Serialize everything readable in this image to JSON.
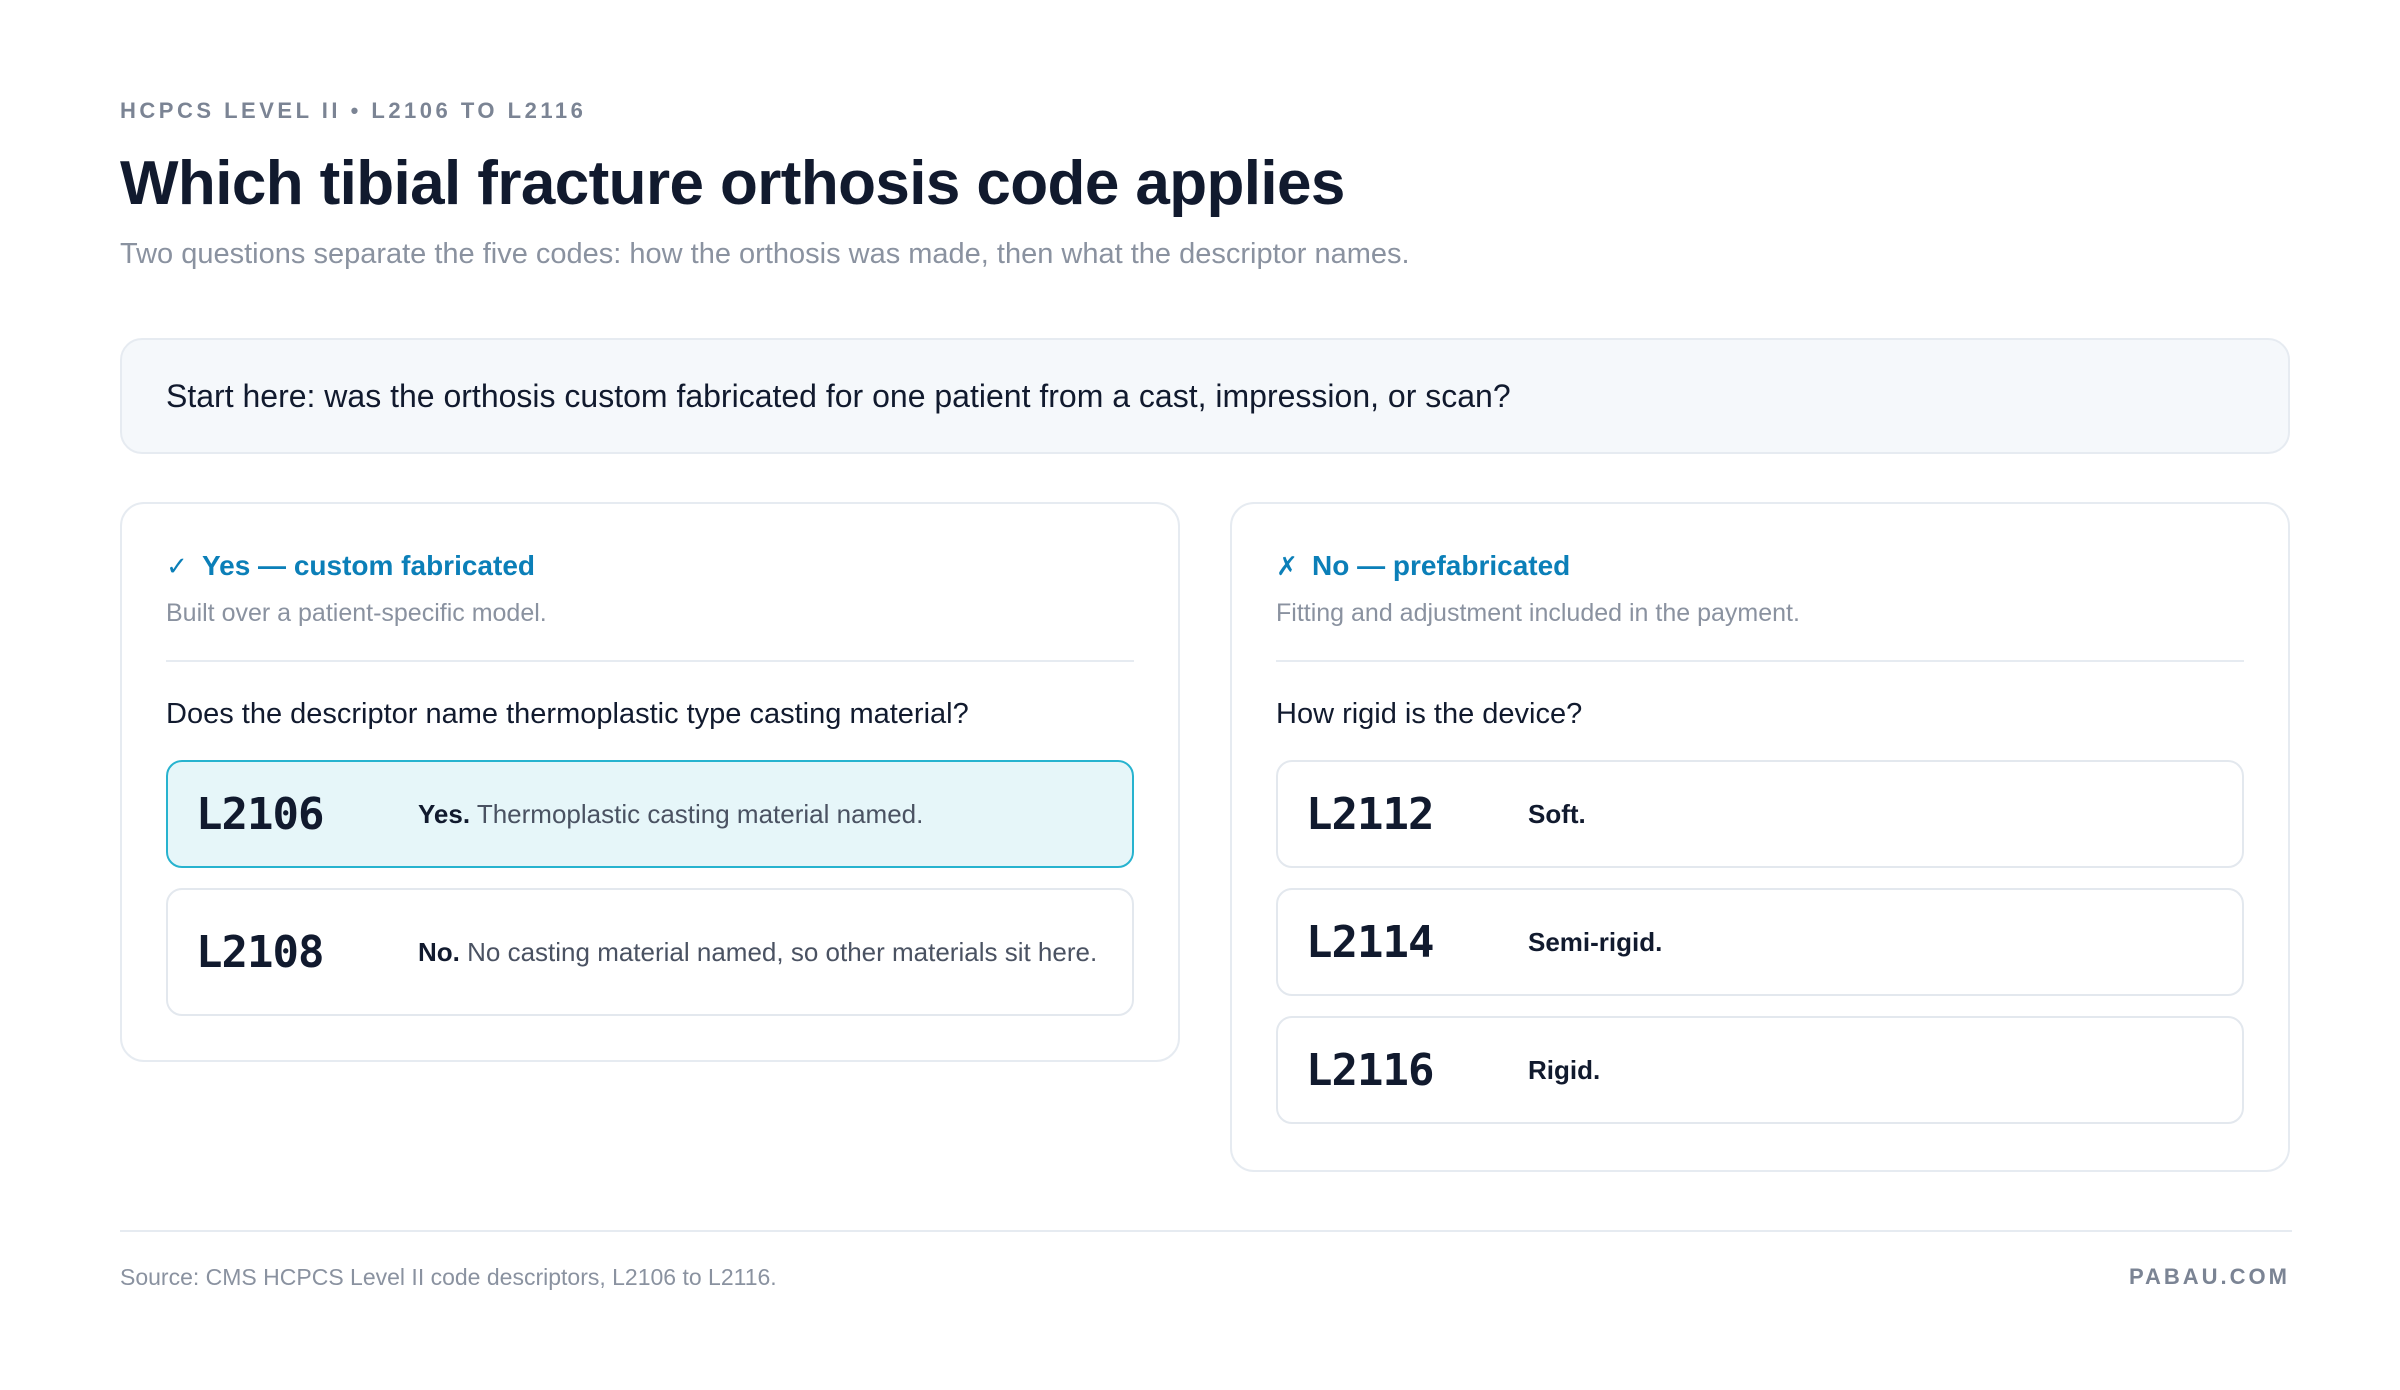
{
  "header": {
    "eyebrow": "HCPCS LEVEL II • L2106 TO L2116",
    "title": "Which tibial fracture orthosis code applies",
    "subtitle": "Two questions separate the five codes: how the orthosis was made, then what the descriptor names."
  },
  "start": {
    "text": "Start here: was the orthosis custom fabricated for one patient from a cast, impression, or scan?"
  },
  "left": {
    "icon": "check-icon",
    "icon_glyph": "✓",
    "heading": "Yes — custom fabricated",
    "note": "Built over a patient-specific model.",
    "question": "Does the descriptor name thermoplastic type casting material?",
    "options": [
      {
        "code": "L2106",
        "lead": "Yes.",
        "text": "Thermoplastic casting material named.",
        "highlighted": true
      },
      {
        "code": "L2108",
        "lead": "No.",
        "text": "No casting material named, so other materials sit here.",
        "highlighted": false
      }
    ]
  },
  "right": {
    "icon": "cross-icon",
    "icon_glyph": "✗",
    "heading": "No — prefabricated",
    "note": "Fitting and adjustment included in the payment.",
    "question": "How rigid is the device?",
    "options": [
      {
        "code": "L2112",
        "lead": "Soft.",
        "text": ""
      },
      {
        "code": "L2114",
        "lead": "Semi-rigid.",
        "text": ""
      },
      {
        "code": "L2116",
        "lead": "Rigid.",
        "text": ""
      }
    ]
  },
  "footer": {
    "source": "Source: CMS HCPCS Level II code descriptors, L2106 to L2116.",
    "brand": "PABAU.COM"
  },
  "colors": {
    "accent": "#0b7fb8",
    "highlight_fill": "#e6f6f9",
    "highlight_border": "#27b3cf",
    "text_dark": "#111a2e",
    "text_muted": "#8a92a0"
  }
}
